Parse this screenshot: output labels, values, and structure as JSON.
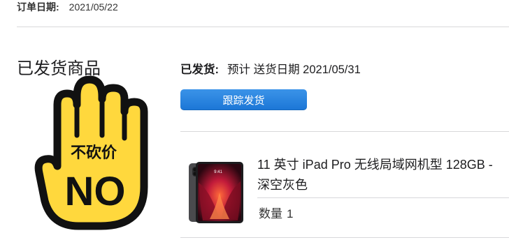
{
  "order": {
    "date_label": "订单日期:",
    "date_value": "2021/05/22"
  },
  "section": {
    "title": "已发货商品"
  },
  "shipment": {
    "status_label": "已发货:",
    "delivery_text": "预计 送货日期 2021/05/31",
    "track_button": "跟踪发货"
  },
  "product": {
    "name": "11 英寸 iPad Pro 无线局域网机型 128GB - 深空灰色",
    "quantity_label": "数量",
    "quantity_value": "1",
    "icon": "ipad-pro-image"
  },
  "sticker": {
    "icon": "raised-hand-icon",
    "text_top": "不砍价",
    "text_bottom": "NO",
    "fill_color": "#FFD83D",
    "outline_color": "#111111"
  },
  "colors": {
    "accent": "#1b76d6",
    "divider": "#d8d8da"
  }
}
